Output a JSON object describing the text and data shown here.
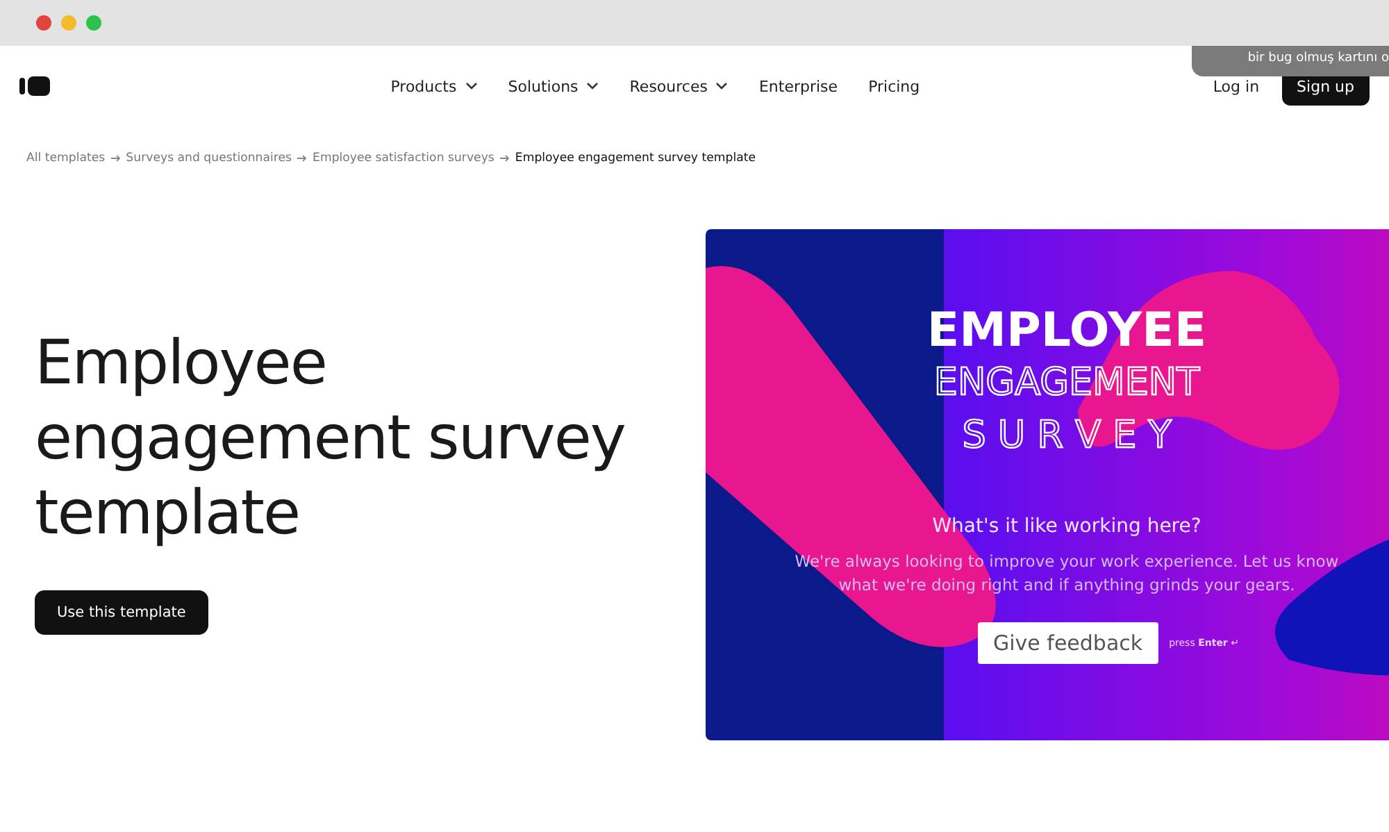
{
  "tooltip": {
    "text": "bir bug olmuş kartını o"
  },
  "nav": {
    "items": [
      {
        "label": "Products",
        "dropdown": true
      },
      {
        "label": "Solutions",
        "dropdown": true
      },
      {
        "label": "Resources",
        "dropdown": true
      },
      {
        "label": "Enterprise",
        "dropdown": false
      },
      {
        "label": "Pricing",
        "dropdown": false
      }
    ],
    "login": "Log in",
    "signup": "Sign up"
  },
  "breadcrumb": [
    {
      "label": "All templates",
      "current": false
    },
    {
      "label": "Surveys and questionnaires",
      "current": false
    },
    {
      "label": "Employee satisfaction surveys",
      "current": false
    },
    {
      "label": "Employee engagement survey template",
      "current": true
    }
  ],
  "hero": {
    "title": "Employee engagement survey template",
    "button": "Use this template"
  },
  "preview": {
    "title_lines": [
      {
        "text": "EMPLOYEE",
        "kind": "solid"
      },
      {
        "text": "ENGAGEMENT",
        "kind": "outline"
      },
      {
        "text": "S U R V E Y",
        "kind": "outline"
      }
    ],
    "question": "What's it like working here?",
    "description": "We're always looking to improve your work experience. Let us know what we're doing right and if anything grinds your gears.",
    "button": "Give feedback",
    "hint": "press **Enter** ↵"
  }
}
